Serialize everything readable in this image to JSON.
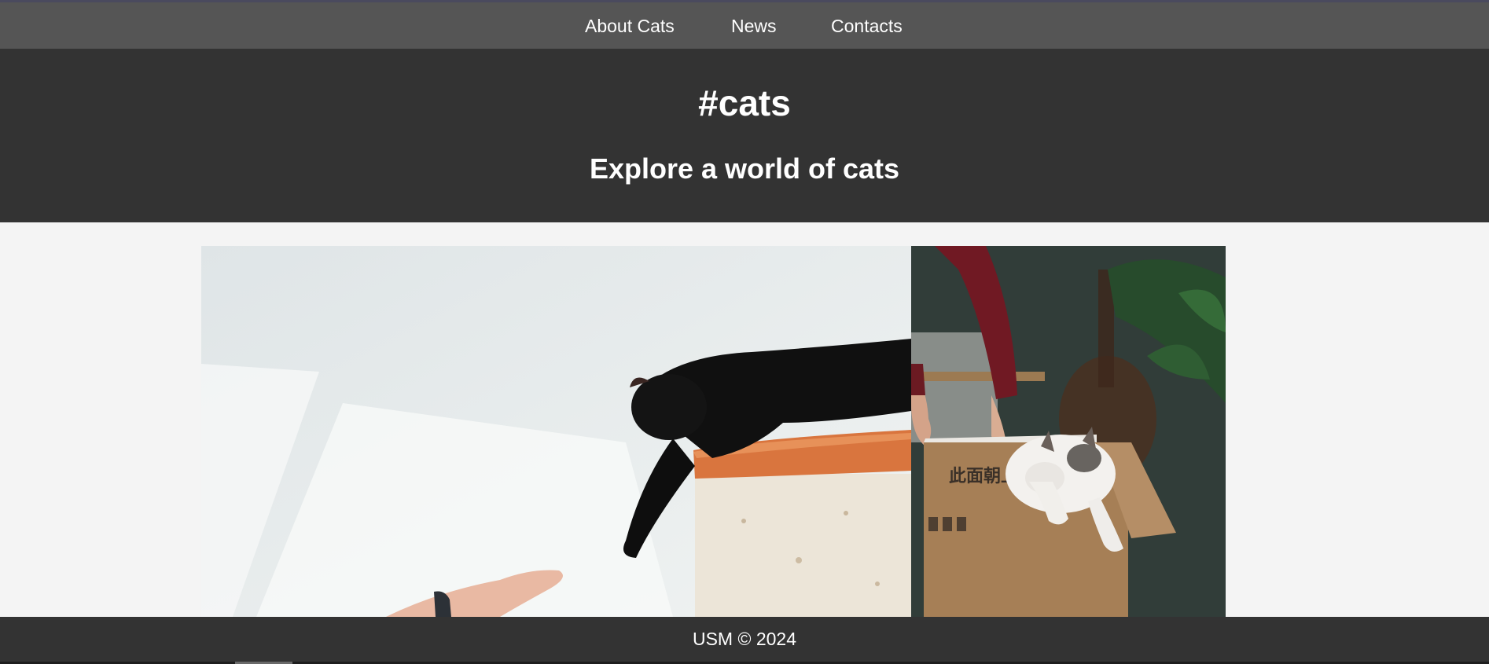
{
  "nav": {
    "items": [
      {
        "label": "About Cats"
      },
      {
        "label": "News"
      },
      {
        "label": "Contacts"
      }
    ]
  },
  "header": {
    "title": "#cats",
    "subtitle": "Explore a world of cats"
  },
  "gallery": {
    "photos": [
      {
        "subject": "black kitten on pillar reaching toward a hand"
      },
      {
        "subject": "white and tabby cat in cardboard box"
      }
    ],
    "box_text": "此面朝上"
  },
  "footer": {
    "text": "USM © 2024"
  }
}
